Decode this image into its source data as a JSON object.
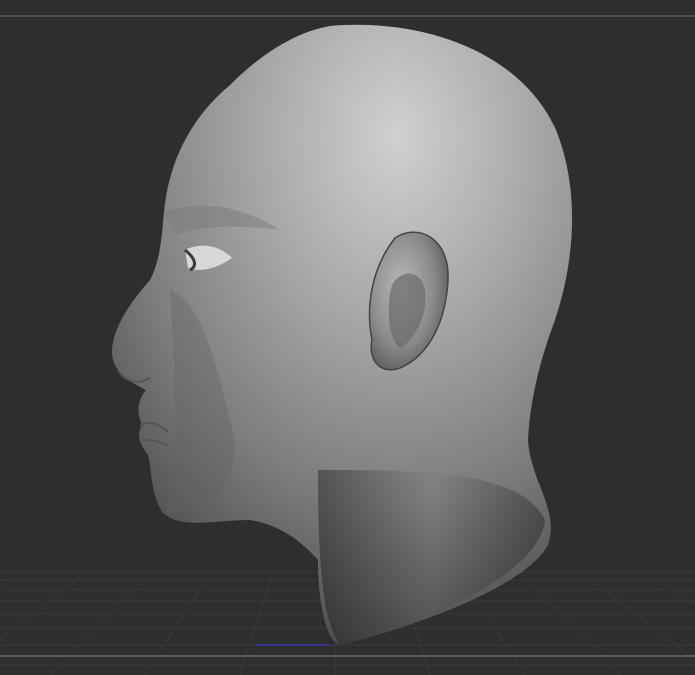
{
  "viewport": {
    "type": "3d-sculpt-canvas",
    "model": "head-bust",
    "colors": {
      "background": "#2e2e2e",
      "frame_line": "#5c5c5c",
      "grid_line": "#3a3a3a",
      "axis_line": "#3a3ab0",
      "mesh_light": "#d2d2d2",
      "mesh_dark": "#3c3c3c"
    }
  }
}
